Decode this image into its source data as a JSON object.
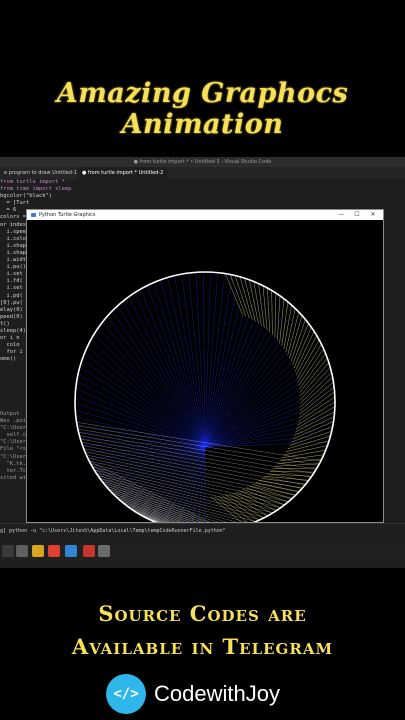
{
  "headline": "Amazing Graphocs Animation",
  "vscode": {
    "window_title": "● from turtle import * • Untitled-3 - Visual Studio Code",
    "tabs": [
      {
        "label": "e program to draw  Untitled-1"
      },
      {
        "label": "● from turtle import *  Untitled-2"
      }
    ],
    "code_lines": [
      "from turtle import *",
      "from time import sleep",
      "",
      "bgcolor(\"black\")",
      "  = [Turt",
      "  = 6",
      "colors =",
      "or index",
      "  i.spee",
      "  i.colo",
      "  i.shap",
      "  i.shap",
      "  i.widt",
      "  i.pu()",
      "  i.set",
      "  i.fd(",
      "  i.set",
      "  i.pd(",
      "[0].pu(",
      "",
      "elay(0)",
      "peed(0)",
      "t()",
      "sleep(4)",
      "or i n",
      "  colo",
      "  for i",
      "",
      "",
      "",
      "",
      "",
      "",
      "ome()",
      "",
      "",
      "",
      "",
      "",
      "",
      "",
      "",
      "",
      ""
    ],
    "terminal_lines": [
      "Output",
      "Wes .poi",
      "\"C:\\Users",
      "  self.c",
      "\"C:\\Users",
      "File \"<string>\"",
      "\"C:\\Users",
      "  ^K.tk.cal",
      "  ter.TclErr",
      "",
      "xited wi"
    ],
    "terminal_prompt": "g] python -u \"c:\\Users\\Jitesh\\AppData\\Local\\Temp\\tempCodeRunnerFile.python\""
  },
  "turtle_window": {
    "title": "Python Turtle Graphics",
    "minimize": "—",
    "maximize": "☐",
    "close": "✕"
  },
  "promo": {
    "line1": "Source Codes are",
    "line2": "Available in Telegram"
  },
  "brand": {
    "logo": "</>",
    "name": "CodewithJoy"
  },
  "colors": {
    "headline": "#f6e05a",
    "blue_lines": "#1a2fff",
    "yellow_lines": "#f5ef5a",
    "white_circle": "#ffffff",
    "brand_logo": "#2fb6ea"
  }
}
